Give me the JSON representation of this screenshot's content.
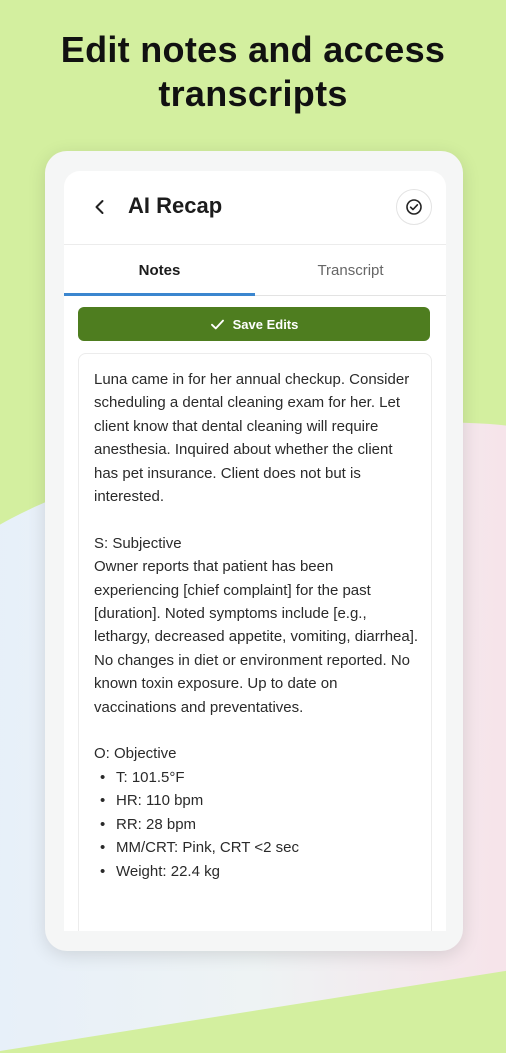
{
  "headline": "Edit notes and access transcripts",
  "app_bar": {
    "title": "AI Recap",
    "back_icon": "chevron-left-icon",
    "action_icon": "check-circle-icon"
  },
  "tabs": [
    {
      "label": "Notes",
      "active": true
    },
    {
      "label": "Transcript",
      "active": false
    }
  ],
  "save_button": {
    "label": "Save Edits",
    "icon": "check-icon"
  },
  "notes": {
    "intro": "Luna came in for her annual checkup. Consider scheduling a dental cleaning exam for her. Let client know that dental cleaning will require anesthesia. Inquired about whether the client has pet insurance. Client does not but is interested.",
    "subjective_heading": "S: Subjective",
    "subjective_text": "Owner reports that patient has been experiencing [chief complaint] for the past [duration]. Noted symptoms include [e.g., lethargy, decreased appetite, vomiting, diarrhea]. No changes in diet or environment reported. No known toxin exposure. Up to date on vaccinations and preventatives.",
    "objective_heading": "O: Objective",
    "objective_items": [
      "T: 101.5°F",
      "HR: 110 bpm",
      "RR: 28 bpm",
      "MM/CRT: Pink, CRT <2 sec",
      "Weight: 22.4 kg"
    ]
  },
  "colors": {
    "background": "#d3ef9f",
    "save_button": "#4e7d1f",
    "tab_indicator": "#3b86cf"
  }
}
